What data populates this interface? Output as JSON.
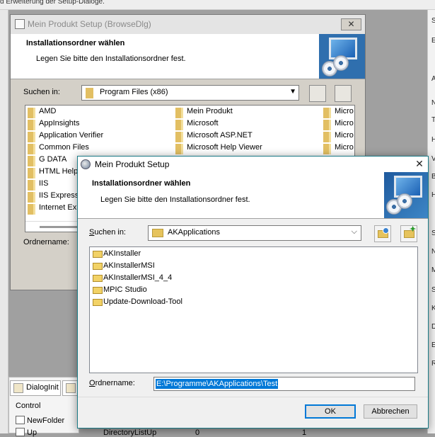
{
  "host": {
    "top_strip_text": "d Erweiterung der Setup-Dialoge.",
    "right_letters": [
      "S",
      "E",
      "A",
      "N",
      "T",
      "H",
      "V",
      "B",
      "H",
      "S",
      "N",
      "M",
      "S",
      "K",
      "D",
      "E",
      "R"
    ],
    "bottom_tabs": [
      "DialogInit",
      ""
    ],
    "bottom_rows": [
      {
        "label": "Control",
        "checkbox": false
      },
      {
        "label": "NewFolder",
        "checkbox": true
      },
      {
        "label": "Up",
        "checkbox": true
      }
    ],
    "bottom_row_extra": {
      "col2": "DirectoryListUp",
      "col3": "0",
      "col4": "1"
    }
  },
  "old_dialog": {
    "title": "Mein Produkt Setup  (BrowseDlg)",
    "header_title": "Installationsordner wählen",
    "header_subtitle": "Legen Sie bitte den Installationsordner fest.",
    "look_in_label": "Suchen in:",
    "look_in_value": "Program Files (x86)",
    "folder_name_label": "Ordnername:",
    "col1": [
      "AMD",
      "AppInsights",
      "Application Verifier",
      "Common Files",
      "G DATA",
      "HTML Help",
      "IIS",
      "IIS Express",
      "Internet Ex"
    ],
    "col2": [
      "Mein Produkt",
      "Microsoft",
      "Microsoft ASP.NET",
      "Microsoft Help Viewer"
    ],
    "col3": [
      "Micro",
      "Micro",
      "Micro",
      "Micro"
    ]
  },
  "dialog": {
    "title": "Mein Produkt Setup",
    "header_title": "Installationsordner wählen",
    "header_subtitle": "Legen Sie bitte den Installationsordner fest.",
    "look_in_label_u": "S",
    "look_in_label_rest": "uchen in:",
    "look_in_value": "AKApplications",
    "folders": [
      "AKInstaller",
      "AKInstallerMSI",
      "AKInstallerMSI_4_4",
      "MPIC Studio",
      "Update-Download-Tool"
    ],
    "folder_name_label_u": "O",
    "folder_name_label_rest": "rdnername:",
    "folder_name_value": "E:\\Programme\\AKApplications\\Test",
    "ok_label": "OK",
    "cancel_label": "Abbrechen",
    "close_glyph": "✕"
  }
}
